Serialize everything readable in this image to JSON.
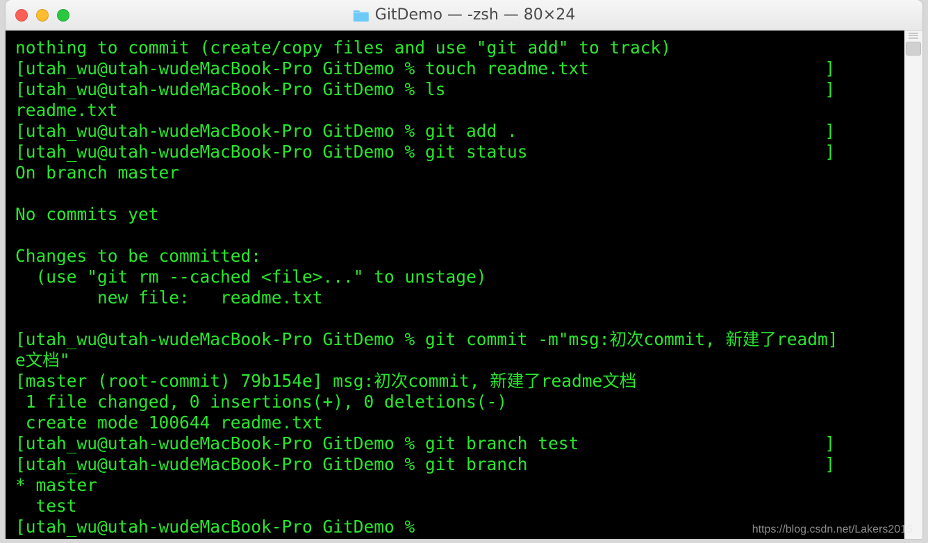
{
  "window": {
    "title": "GitDemo — -zsh — 80×24"
  },
  "terminal": {
    "lines": [
      {
        "type": "plain",
        "text": "nothing to commit (create/copy files and use \"git add\" to track)"
      },
      {
        "type": "prompt",
        "prefix": "[",
        "prompt": "utah_wu@utah-wudeMacBook-Pro GitDemo % ",
        "cmd": "touch readme.txt",
        "suffix": "]"
      },
      {
        "type": "prompt",
        "prefix": "[",
        "prompt": "utah_wu@utah-wudeMacBook-Pro GitDemo % ",
        "cmd": "ls",
        "suffix": "]"
      },
      {
        "type": "plain",
        "text": "readme.txt"
      },
      {
        "type": "prompt",
        "prefix": "[",
        "prompt": "utah_wu@utah-wudeMacBook-Pro GitDemo % ",
        "cmd": "git add .",
        "suffix": "]"
      },
      {
        "type": "prompt",
        "prefix": "[",
        "prompt": "utah_wu@utah-wudeMacBook-Pro GitDemo % ",
        "cmd": "git status",
        "suffix": "]"
      },
      {
        "type": "plain",
        "text": "On branch master"
      },
      {
        "type": "plain",
        "text": ""
      },
      {
        "type": "plain",
        "text": "No commits yet"
      },
      {
        "type": "plain",
        "text": ""
      },
      {
        "type": "plain",
        "text": "Changes to be committed:"
      },
      {
        "type": "plain",
        "text": "  (use \"git rm --cached <file>...\" to unstage)"
      },
      {
        "type": "plain",
        "text": "        new file:   readme.txt"
      },
      {
        "type": "plain",
        "text": ""
      },
      {
        "type": "prompt",
        "prefix": "[",
        "prompt": "utah_wu@utah-wudeMacBook-Pro GitDemo % ",
        "cmd": "git commit -m\"msg:初次commit, 新建了readm",
        "suffix": "]"
      },
      {
        "type": "plain",
        "text": "e文档\""
      },
      {
        "type": "plain",
        "text": "[master (root-commit) 79b154e] msg:初次commit, 新建了readme文档"
      },
      {
        "type": "plain",
        "text": " 1 file changed, 0 insertions(+), 0 deletions(-)"
      },
      {
        "type": "plain",
        "text": " create mode 100644 readme.txt"
      },
      {
        "type": "prompt",
        "prefix": "[",
        "prompt": "utah_wu@utah-wudeMacBook-Pro GitDemo % ",
        "cmd": "git branch test",
        "suffix": "]"
      },
      {
        "type": "prompt",
        "prefix": "[",
        "prompt": "utah_wu@utah-wudeMacBook-Pro GitDemo % ",
        "cmd": "git branch",
        "suffix": "]"
      },
      {
        "type": "plain",
        "text": "* master"
      },
      {
        "type": "plain",
        "text": "  test"
      },
      {
        "type": "prompt",
        "prefix": "[",
        "prompt": "utah_wu@utah-wudeMacBook-Pro GitDemo % ",
        "cmd": "",
        "suffix": ""
      }
    ]
  },
  "watermark": "https://blog.csdn.net/Lakers2015"
}
